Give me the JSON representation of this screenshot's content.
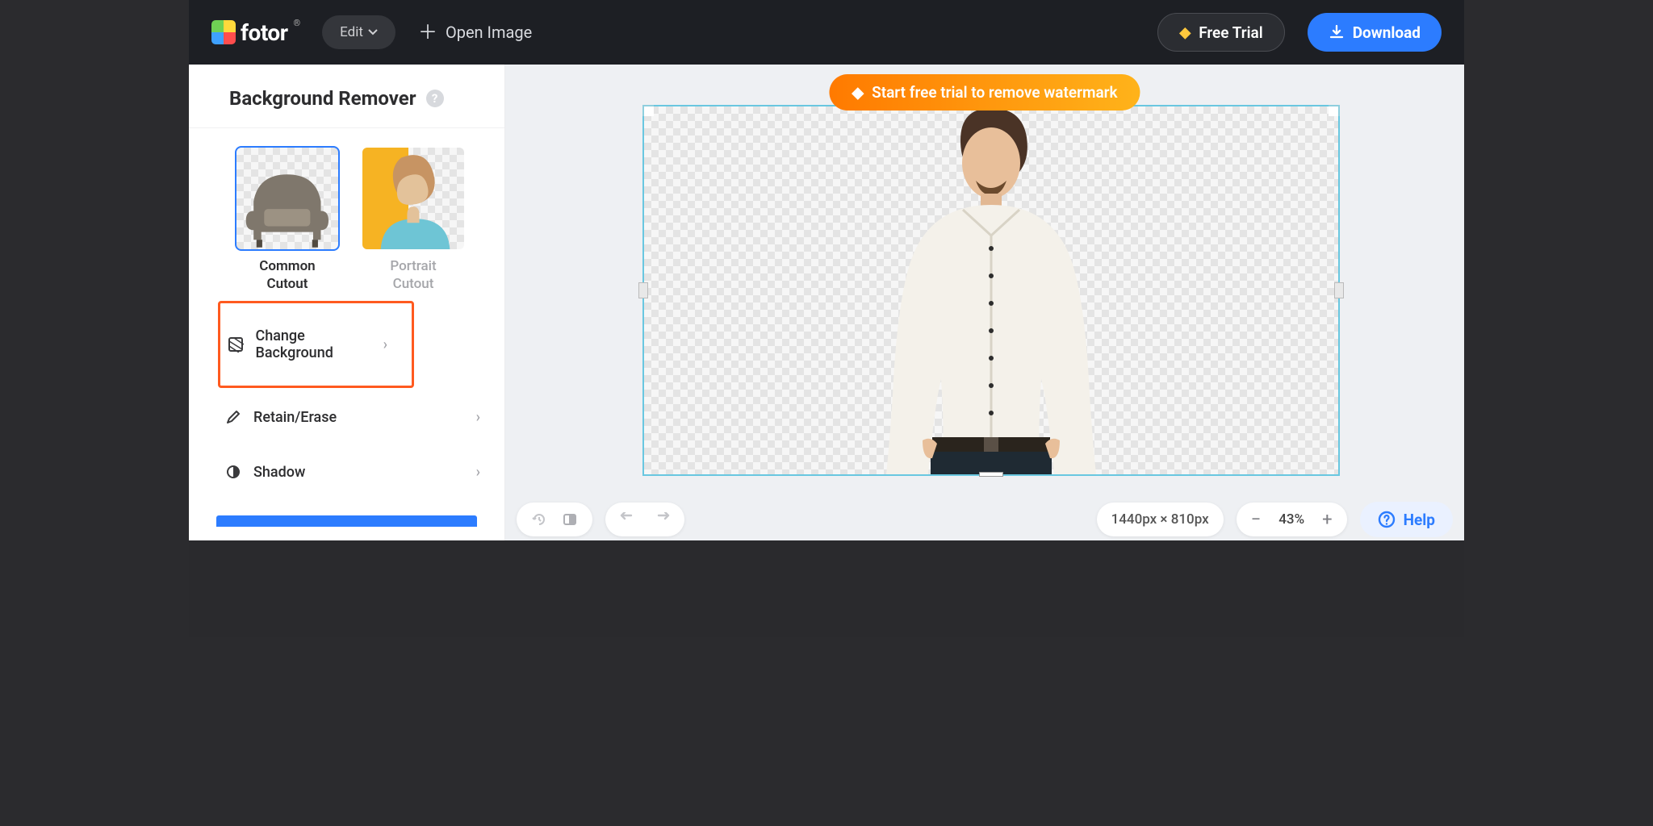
{
  "header": {
    "brand": "fotor",
    "edit_label": "Edit",
    "open_image": "Open Image",
    "free_trial": "Free Trial",
    "download": "Download"
  },
  "sidebar": {
    "title": "Background Remover",
    "thumbs": [
      {
        "label_l1": "Common",
        "label_l2": "Cutout",
        "selected": true
      },
      {
        "label_l1": "Portrait",
        "label_l2": "Cutout",
        "selected": false
      }
    ],
    "options": [
      {
        "label": "Change Background",
        "highlighted": true
      },
      {
        "label": "Retain/Erase",
        "highlighted": false
      },
      {
        "label": "Shadow",
        "highlighted": false
      }
    ]
  },
  "canvas": {
    "banner": "Start free trial to remove watermark",
    "dimensions": "1440px × 810px",
    "zoom_percent": "43%",
    "help": "Help"
  }
}
